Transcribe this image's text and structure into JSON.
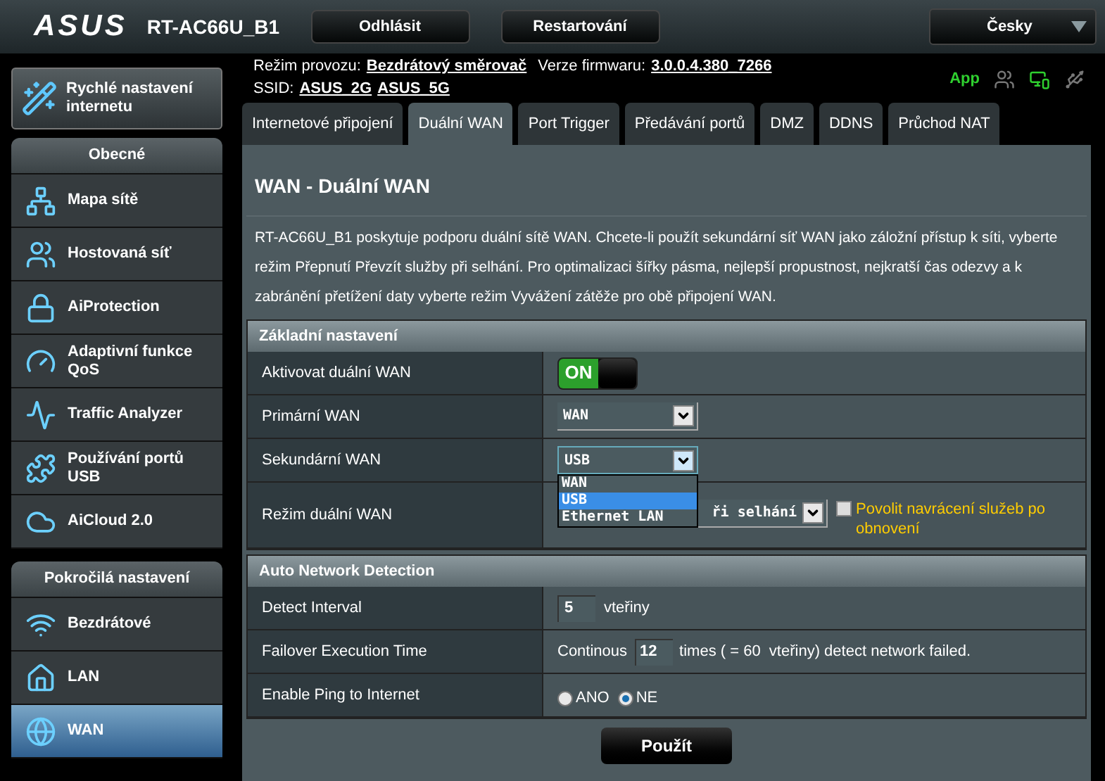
{
  "header": {
    "logo": "ASUS",
    "model": "RT-AC66U_B1",
    "buttons": [
      "Odhlásit",
      "Restartování"
    ],
    "language": "Česky"
  },
  "info": {
    "mode_label": "Režim provozu:",
    "mode": "Bezdrátový směrovač",
    "fw_label": "Verze firmwaru:",
    "fw": "3.0.0.4.380_7266",
    "ssid_label": "SSID:",
    "ssids": [
      "ASUS_2G",
      "ASUS_5G"
    ],
    "app": "App"
  },
  "quick_setup": "Rychlé nastavení internetu",
  "sidebar": [
    {
      "title": "Obecné",
      "items": [
        {
          "label": "Mapa sítě",
          "selected": false
        },
        {
          "label": "Hostovaná síť",
          "selected": false
        },
        {
          "label": "AiProtection",
          "selected": false
        },
        {
          "label": "Adaptivní funkce QoS",
          "selected": false
        },
        {
          "label": "Traffic Analyzer",
          "selected": false
        },
        {
          "label": "Používání portů USB",
          "selected": false
        },
        {
          "label": "AiCloud 2.0",
          "selected": false
        }
      ]
    },
    {
      "title": "Pokročilá nastavení",
      "items": [
        {
          "label": "Bezdrátové",
          "selected": false
        },
        {
          "label": "LAN",
          "selected": false
        },
        {
          "label": "WAN",
          "selected": true
        }
      ]
    }
  ],
  "tabs": [
    {
      "label": "Internetové připojení",
      "selected": false
    },
    {
      "label": "Duální WAN",
      "selected": true
    },
    {
      "label": "Port Trigger",
      "selected": false
    },
    {
      "label": "Předávání portů",
      "selected": false
    },
    {
      "label": "DMZ",
      "selected": false
    },
    {
      "label": "DDNS",
      "selected": false
    },
    {
      "label": "Průchod NAT",
      "selected": false
    }
  ],
  "title": "WAN - Duální WAN",
  "description": "RT-AC66U_B1 poskytuje podporu duální sítě WAN. Chcete-li použít sekundární síť WAN jako záložní přístup k síti, vyberte režim Přepnutí Převzít služby při selhání. Pro optimalizaci šířky pásma, nejlepší propustnost, nejkratší čas odezvy a k zabránění přetížení daty vyberte režim Vyvážení zátěže pro obě připojení WAN.",
  "sections": [
    {
      "title": "Základní nastavení",
      "rows": [
        {
          "kind": "toggle",
          "label": "Aktivovat duální WAN",
          "value": "ON",
          "on": true
        },
        {
          "kind": "select",
          "label": "Primární WAN",
          "value": "WAN"
        },
        {
          "kind": "open-select",
          "label": "Sekundární WAN",
          "value": "USB",
          "options": [
            {
              "label": "WAN",
              "selected": false
            },
            {
              "label": "USB",
              "selected": true
            },
            {
              "label": "Ethernet LAN",
              "selected": false
            }
          ]
        },
        {
          "kind": "mode",
          "label": "Režim duální WAN",
          "value": "ři selhání",
          "checkbox": "Povolit navrácení služeb po obnovení",
          "checked": false
        }
      ]
    },
    {
      "title": "Auto Network Detection",
      "rows": [
        {
          "kind": "input",
          "label": "Detect Interval",
          "value": "5",
          "unit": "vteřiny"
        },
        {
          "kind": "failover",
          "label": "Failover Execution Time",
          "before": "Continous",
          "value": "12",
          "after": "times ( = 60  vteřiny) detect network failed."
        },
        {
          "kind": "radio",
          "label": "Enable Ping to Internet",
          "options": [
            {
              "label": "ANO",
              "selected": false
            },
            {
              "label": "NE",
              "selected": true
            }
          ]
        }
      ]
    }
  ],
  "apply": "Použít"
}
